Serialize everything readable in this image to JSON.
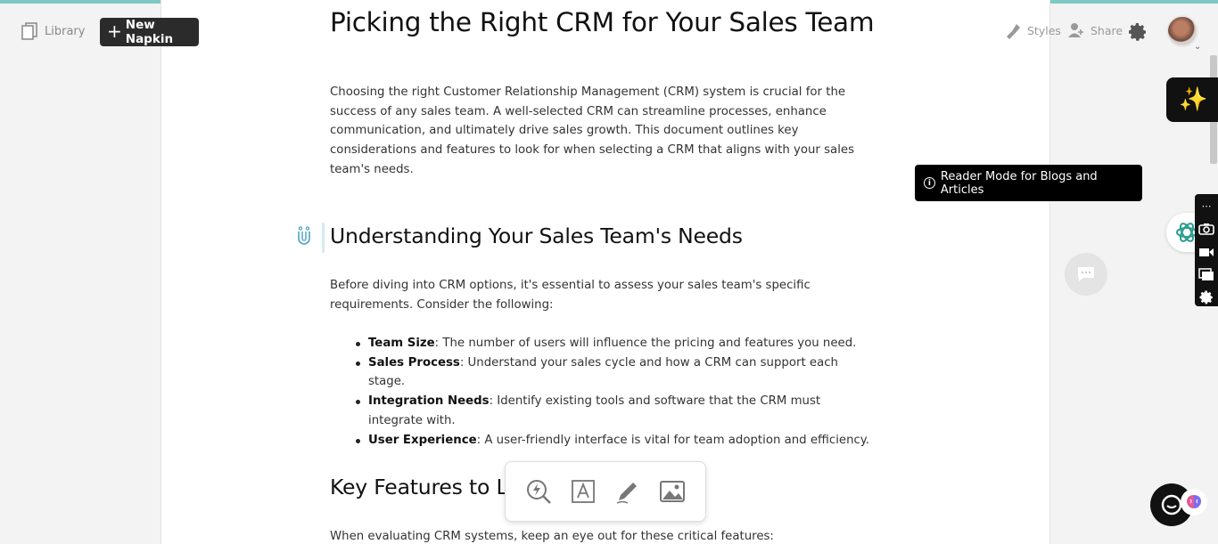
{
  "header": {
    "library_label": "Library",
    "new_napkin_label": "New Napkin",
    "styles_label": "Styles",
    "share_label": "Share"
  },
  "document": {
    "title": "Picking the Right CRM for Your Sales Team",
    "intro": "Choosing the right Customer Relationship Management (CRM) system is crucial for the success of any sales team. A well-selected CRM can streamline processes, enhance communication, and ultimately drive sales growth. This document outlines key considerations and features to look for when selecting a CRM that aligns with your sales team's needs.",
    "section1_heading": "Understanding Your Sales Team's Needs",
    "section1_intro": "Before diving into CRM options, it's essential to assess your sales team's specific requirements. Consider the following:",
    "needs": [
      {
        "term": "Team Size",
        "desc": ": The number of users will influence the pricing and features you need."
      },
      {
        "term": "Sales Process",
        "desc": ": Understand your sales cycle and how a CRM can support each stage."
      },
      {
        "term": "Integration Needs",
        "desc": ": Identify existing tools and software that the CRM must integrate with."
      },
      {
        "term": "User Experience",
        "desc": ": A user-friendly interface is vital for team adoption and efficiency."
      }
    ],
    "section2_heading_visible": "Key Features to L",
    "section2_intro": "When evaluating CRM systems, keep an eye out for these critical features:"
  },
  "overlays": {
    "reader_mode_tooltip": "Reader Mode for Blogs and Articles",
    "info_glyph": "i"
  },
  "colors": {
    "accent_top": "#7fc9c3",
    "sparkle": "#f8d34a",
    "dark_button": "#2b2b2b"
  },
  "icons": [
    "library-icon",
    "plus-icon",
    "styles-icon",
    "share-icon",
    "gear-icon",
    "magnet-icon",
    "generate-icon",
    "text-box-icon",
    "pen-icon",
    "image-icon",
    "sparkle-icon",
    "chatgpt-icon",
    "camera-icon",
    "video-icon",
    "screens-icon",
    "settings-icon",
    "chat-icon",
    "help-icon",
    "brain-icon"
  ]
}
